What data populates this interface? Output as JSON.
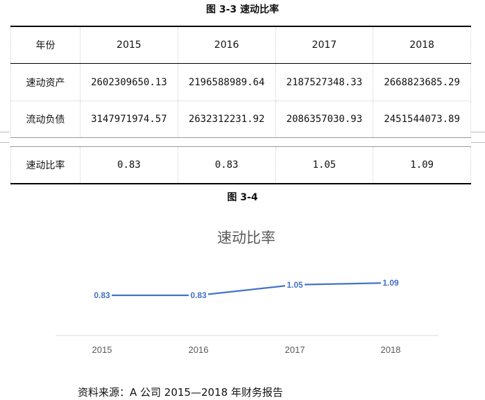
{
  "table_caption": "图 3-3 速动比率",
  "table": {
    "header": [
      "年份",
      "2015",
      "2016",
      "2017",
      "2018"
    ],
    "rows": [
      {
        "label": "速动资产",
        "values": [
          "2602309650.13",
          "2196588989.64",
          "2187527348.33",
          "2668823685.29"
        ]
      },
      {
        "label": "流动负债",
        "values": [
          "3147971974.57",
          "2632312231.92",
          "2086357030.93",
          "2451544073.89"
        ]
      },
      {
        "label": "速动比率",
        "values": [
          "0.83",
          "0.83",
          "1.05",
          "1.09"
        ]
      }
    ]
  },
  "figure_caption": "图 3-4",
  "chart_data": {
    "type": "line",
    "title": "速动比率",
    "categories": [
      "2015",
      "2016",
      "2017",
      "2018"
    ],
    "series": [
      {
        "values": [
          0.83,
          0.83,
          1.05,
          1.09
        ],
        "color": "#4472c4"
      }
    ],
    "data_labels": [
      "0.83",
      "0.83",
      "1.05",
      "1.09"
    ],
    "grid": false,
    "legend": "none"
  },
  "source_note": "资料来源：A 公司 2015—2018 年财务报告"
}
